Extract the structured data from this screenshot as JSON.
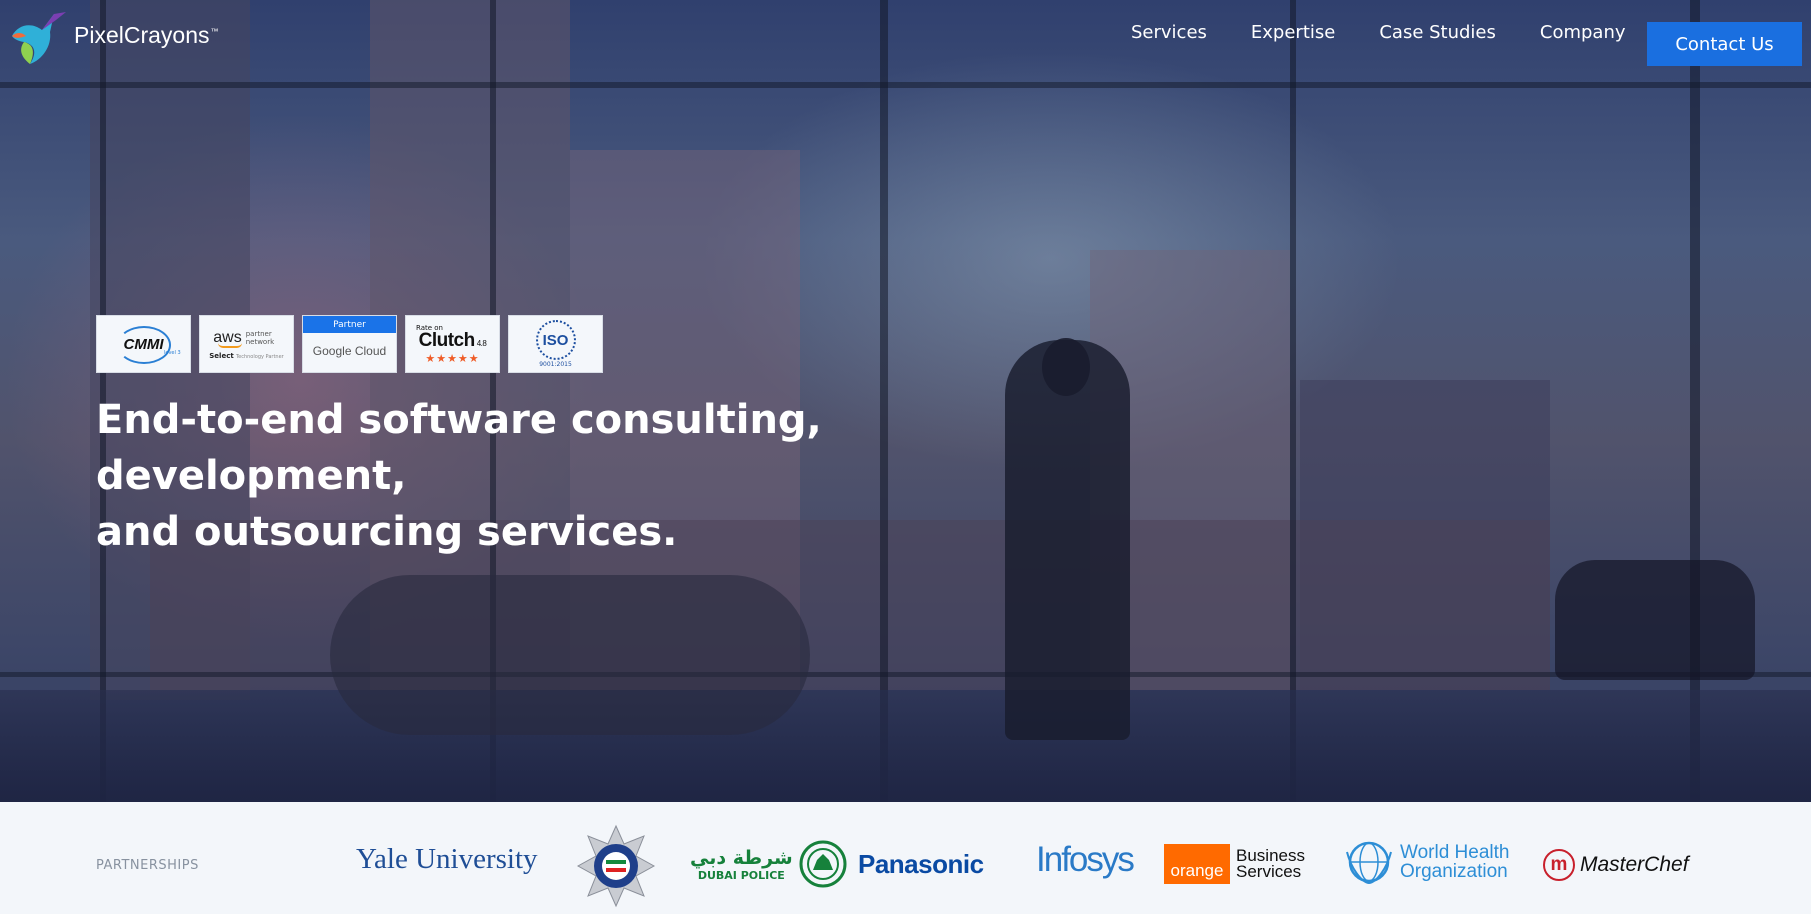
{
  "brand": {
    "name": "PixelCrayons",
    "tm": "™"
  },
  "nav": {
    "items": [
      "Services",
      "Expertise",
      "Case Studies",
      "Company"
    ],
    "cta": "Contact Us"
  },
  "badges": {
    "cmmi": {
      "main": "CMMI",
      "sub": "level 3"
    },
    "aws": {
      "main": "aws",
      "network": "partner network",
      "select": "Select",
      "tier": "Technology Partner"
    },
    "google": {
      "top": "Partner",
      "main": "Google Cloud"
    },
    "clutch": {
      "rate": "Rate on",
      "main": "Clutch",
      "score": "4.8",
      "stars": "★★★★★"
    },
    "iso": {
      "main": "ISO",
      "sub": "9001:2015"
    }
  },
  "hero": {
    "headline_line1": "End-to-end software consulting, development,",
    "headline_line2": "and outsourcing services."
  },
  "partners": {
    "label": "PARTNERSHIPS",
    "yale": "Yale University",
    "dubai_ar": "شرطة دبي",
    "dubai_en": "DUBAI POLICE",
    "panasonic": "Panasonic",
    "infosys": "Infosys",
    "orange_box": "orange",
    "orange_text_1": "Business",
    "orange_text_2": "Services",
    "who_1": "World Health",
    "who_2": "Organization",
    "mc_letter": "m",
    "masterchef": "MasterChef"
  },
  "colors": {
    "cta": "#1a6fe0",
    "headline": "#ffffff",
    "partners_bg": "#f3f6fa"
  }
}
